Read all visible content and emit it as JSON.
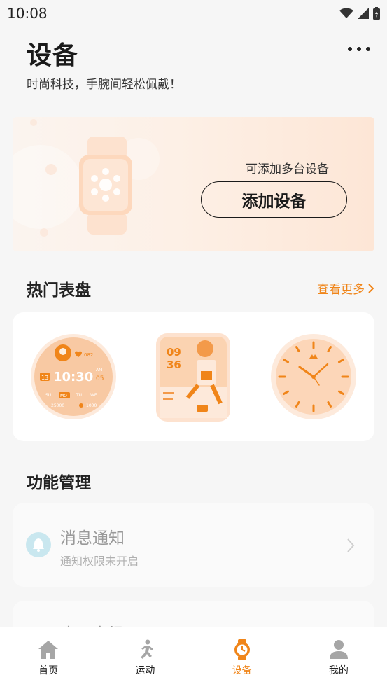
{
  "status_bar": {
    "time": "10:08"
  },
  "header": {
    "title": "设备",
    "subtitle": "时尚科技，手腕间轻松佩戴！"
  },
  "banner": {
    "hint": "可添加多台设备",
    "add_button": "添加设备"
  },
  "hot_faces": {
    "title": "热门表盘",
    "see_more": "查看更多",
    "faces": [
      {
        "name": "digital",
        "hr": "082",
        "time": "10:30",
        "date": "13",
        "temp_label": "AM",
        "temp": "05",
        "days": [
          "SU",
          "MO",
          "TU",
          "WE"
        ],
        "active_day": "MO",
        "steps": "25000",
        "kcal": "1000"
      },
      {
        "name": "cartoon",
        "hour": "09",
        "minute": "36"
      },
      {
        "name": "analog"
      }
    ]
  },
  "features": {
    "title": "功能管理",
    "items": [
      {
        "title": "消息通知",
        "subtitle": "通知权限未开启",
        "icon": "bell-icon"
      },
      {
        "title": "应用市场",
        "icon": "app-icon"
      }
    ]
  },
  "bottom_nav": [
    {
      "label": "首页",
      "icon": "home-icon",
      "active": false
    },
    {
      "label": "运动",
      "icon": "runner-icon",
      "active": false
    },
    {
      "label": "设备",
      "icon": "watch-icon",
      "active": true
    },
    {
      "label": "我的",
      "icon": "person-icon",
      "active": false
    }
  ],
  "colors": {
    "accent": "#f08519",
    "face_bg": "#fde3cf",
    "face_orange": "#f39a4a",
    "bell_bg": "#c9e7ef"
  }
}
